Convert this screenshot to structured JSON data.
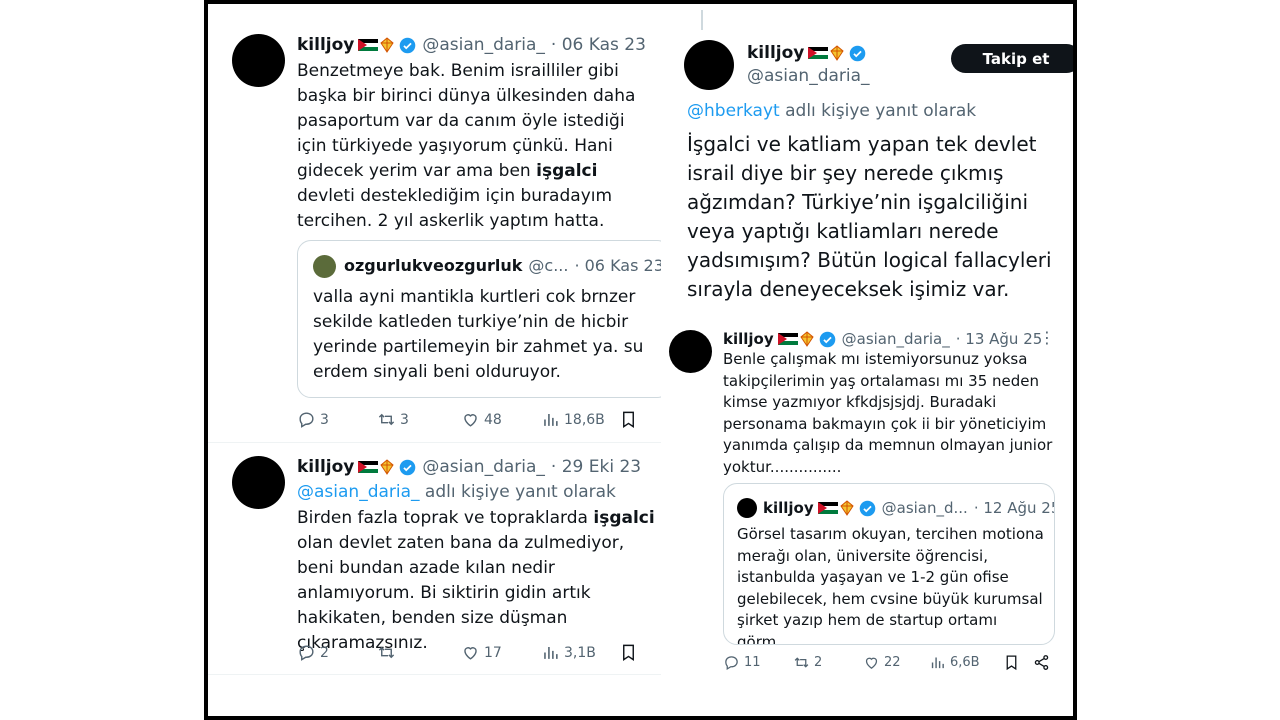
{
  "tweet1": {
    "name": "killjoy",
    "handle": "@asian_daria_",
    "date": "· 06 Kas 23",
    "text_1": "Benzetmeye bak. Benim israilliler gibi başka bir birinci dünya ülkesinden daha pasaportum var da canım öyle istediği için türkiyede yaşıyorum çünkü. Hani gidecek yerim var ama ben ",
    "text_bold": "işgalci",
    "text_2": " devleti desteklediğim için buradayım tercihen. 2 yıl askerlik yaptım hatta.",
    "quote": {
      "name": "ozgurlukveozgurluk",
      "handle": "@c...",
      "date": "· 06 Kas 23",
      "text": "valla ayni mantikla kurtleri cok brnzer sekilde katleden turkiye’nin de hicbir yerinde partilemeyin bir zahmet ya. su erdem sinyali beni olduruyor."
    },
    "replies": "3",
    "retweets": "3",
    "likes": "48",
    "views": "18,6B"
  },
  "tweet2": {
    "name": "killjoy",
    "handle": "@asian_daria_",
    "date": "· 29 Eki 23",
    "reply_handle": "@asian_daria_",
    "reply_suffix": " adlı kişiye yanıt olarak",
    "text_1": "Birden fazla toprak ve topraklarda ",
    "text_bold": "işgalci",
    "text_2": " olan devlet zaten bana da zulmediyor, beni bundan azade kılan nedir anlamıyorum. Bi siktirin gidin artık hakikaten, benden size düşman çıkaramazsınız.",
    "replies": "2",
    "retweets": "",
    "likes": "17",
    "views": "3,1B"
  },
  "tweet3": {
    "name": "killjoy",
    "handle": "@asian_daria_",
    "follow_label": "Takip et",
    "reply_handle": "@hberkayt",
    "reply_suffix": " adlı kişiye yanıt olarak",
    "text": "İşgalci ve katliam yapan tek devlet israil diye bir şey nerede çıkmış ağzımdan? Türkiye’nin işgalciliğini veya yaptığı katliamları nerede yadsımışım? Bütün logical fallacyleri sırayla deneyeceksek işimiz var."
  },
  "tweet4": {
    "name": "killjoy",
    "handle": "@asian_daria_",
    "date": "· 13 Ağu 25",
    "text": "Benle çalışmak mı istemiyorsunuz yoksa takipçilerimin yaş ortalaması mı 35 neden kimse yazmıyor kfkdjsjsjdj. Buradaki personama bakmayın çok ii bir yöneticiyim yanımda çalışıp da memnun olmayan junior yoktur...............",
    "quote": {
      "name": "killjoy",
      "handle": "@asian_d...",
      "date": "· 12 Ağu 25",
      "text": "Görsel tasarım okuyan, tercihen motiona merağı olan, üniversite öğrencisi, istanbulda yaşayan ve 1-2 gün ofise gelebilecek, hem cvsine büyük kurumsal şirket yazıp hem de startup ortamı görm..."
    },
    "replies": "11",
    "retweets": "2",
    "likes": "22",
    "views": "6,6B"
  },
  "colors": {
    "accent": "#1d9bf0",
    "text": "#0f1419",
    "muted": "#536471",
    "border": "#cfd9de"
  },
  "icons": [
    "reply-icon",
    "retweet-icon",
    "like-icon",
    "views-icon",
    "bookmark-icon",
    "share-icon",
    "verified-icon",
    "palestine-flag-icon",
    "kite-icon",
    "more-icon"
  ]
}
